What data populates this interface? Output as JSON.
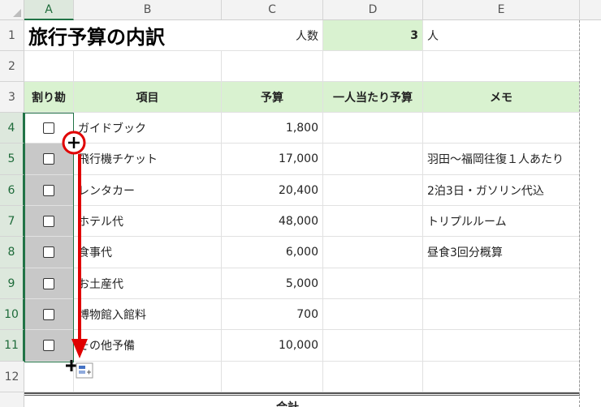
{
  "columns": [
    "A",
    "B",
    "C",
    "D",
    "E"
  ],
  "rows": [
    "1",
    "2",
    "3",
    "4",
    "5",
    "6",
    "7",
    "8",
    "9",
    "10",
    "11",
    "12"
  ],
  "r1": {
    "title": "旅行予算の内訳",
    "people_label": "人数",
    "people_value": "3",
    "people_unit": "人"
  },
  "headers": {
    "a": "割り勘",
    "b": "項目",
    "c": "予算",
    "d": "一人当たり予算",
    "e": "メモ"
  },
  "items": [
    {
      "name": "ガイドブック",
      "budget": "1,800",
      "memo": ""
    },
    {
      "name": "飛行機チケット",
      "budget": "17,000",
      "memo": "羽田～福岡往復１人あたり"
    },
    {
      "name": "レンタカー",
      "budget": "20,400",
      "memo": "2泊3日・ガソリン代込"
    },
    {
      "name": "ホテル代",
      "budget": "48,000",
      "memo": "トリプルルーム"
    },
    {
      "name": "食事代",
      "budget": "6,000",
      "memo": "昼食3回分概算"
    },
    {
      "name": "お土産代",
      "budget": "5,000",
      "memo": ""
    },
    {
      "name": "博物館入館料",
      "budget": "700",
      "memo": ""
    },
    {
      "name": "その他予備",
      "budget": "10,000",
      "memo": ""
    }
  ],
  "total_label": "合計",
  "colors": {
    "accent": "#217346",
    "header_fill": "#d9f2d0",
    "arrow": "#e00000"
  },
  "icons": {
    "cursor": "crosshair-plus-icon",
    "autofill": "autofill-options-icon",
    "arrow": "drag-down-arrow-icon"
  }
}
